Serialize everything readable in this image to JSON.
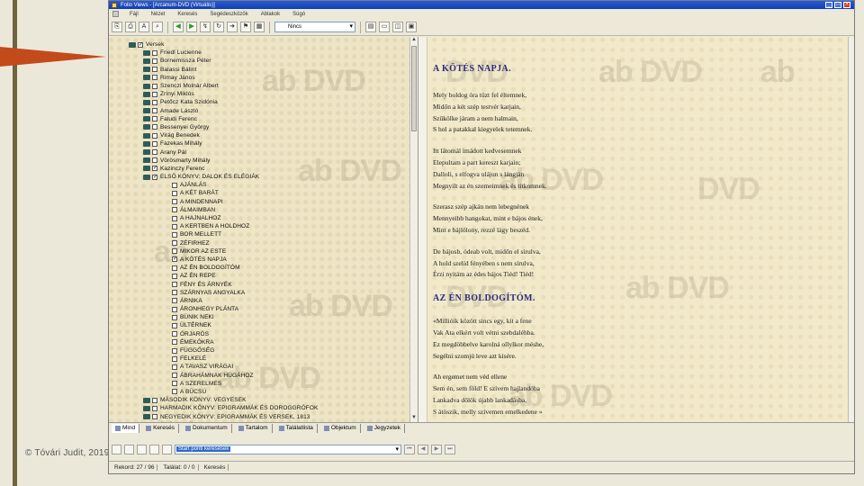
{
  "slide": {
    "copyright": "© Tóvári Judit, 2019"
  },
  "window": {
    "title": "Folio Views - [Arcanum-DVD (Virtuális)]"
  },
  "menu": [
    "Fájl",
    "Nézet",
    "Keresés",
    "Segédeszközök",
    "Ablakok",
    "Súgó"
  ],
  "toolbar": {
    "style_select_value": "Nincs"
  },
  "tree": {
    "root": "Versek",
    "poets": [
      "Friedl Lucienne",
      "Bornemissza Péter",
      "Balassi Bálint",
      "Rimay János",
      "Szenczi Molnár Albert",
      "Zrínyi Miklós",
      "Petőcz Kata Szidónia",
      "Amade László",
      "Faludi Ferenc",
      "Bessenyei György",
      "Virág Benedek",
      "Fazekas Mihály",
      "Arany Pál",
      "Vörösmarty Mihály"
    ],
    "poet_open": "Kazinczy Ferenc",
    "book_open": "ELSŐ KÖNYV: DALOK ÉS ELÉGIÁK",
    "poems": [
      "AJÁNLÁS",
      "A KÉT BARÁT",
      "A MINDENNAPI",
      "ÁLMAIMBAN",
      "A HAJNALHOZ",
      "A KERTBEN A HOLDHOZ",
      "BOR MELLETT",
      "ZÉFIRHEZ",
      "MIKOR AZ ESTE",
      "A KÖTÉS NAPJA",
      "AZ ÉN BOLDOGÍTÓM",
      "AZ ÉN REPE",
      "FÉNY ÉS ÁRNYÉK",
      "SZÁRNYAS ANGYALKA",
      "ÁRNIKA",
      "ÁRONHEGY PLÁNTA",
      "BÚNIK NEKI",
      "ÜLTÉRNEK",
      "ÓRJARÓS",
      "ÉMEKÓKRA",
      "FÜGGÖSÉG",
      "FELKELÉ",
      "A TAVASZ VIRÁGAI",
      "ÁBRAHÁMNAK HÚGÁHOZ",
      "A SZERELMES",
      "A BÚCSÚ"
    ],
    "checked_poem_index": 9,
    "books_after": [
      "MÁSODIK KÖNYV: VEGYESEK",
      "HARMADIK KÖNYV: EPIGRAMMÁK ÉS DOROGGRÓFOK",
      "NEGYEDIK KÖNYV: EPIGRAMMÁK ÉS VERSEK, 1813",
      "ÖTÖDIK KÖNYV: ALKALMI VERSEK"
    ]
  },
  "document": {
    "poem1_title": "A KÖTÉS NAPJA.",
    "poem1_stanzas": [
      [
        "Mely boldog óra tüzt fel éltemnek,",
        "Midőn a két szép testvér karjain,",
        "Szűkölke járam a nem halmain,",
        "S hol a patakkal kiegyelek tetemnek."
      ],
      [
        "Itt látomál imádott kedvesemnek",
        "Elepultam a part kereszt karjain;",
        "Dalloli, s elfogva ulájun s lángján",
        "Megnyílt az én szemeimnek és titkomnek."
      ],
      [
        "Szerasz szép ajkán nem lebegnének",
        "Mennyeibb hangokat, mint e bájos ének,",
        "Mint e bájlólony, rezzé lágy beszéd."
      ],
      [
        "De bájosb, ódeab volt, midőn el sírulva,",
        "A hold szelíd fényében s nem sírulva,",
        "Érzi nyitám az édes bájos Tiéd! Tiéd!"
      ]
    ],
    "poem2_title": "AZ ÉN BOLDOGÍTÓM.",
    "poem2_stanzas": [
      [
        "«Millióik között sincs egy, kit a fene",
        "Vak Ata elkért volt vétni szebdaléhba.",
        "Ez megdöbbelve karolná ollylkor méshe,",
        "Segélni szomjú leve azt kisére."
      ],
      [
        "Ah ergemet nem véd ellene",
        "Sem én, sem föld! E szívem hajlandóba",
        "Lankadva dőlök újabb lankadásba,",
        "S átöszik, melly szívemen emelkedene »"
      ]
    ]
  },
  "tabs": [
    "Mind",
    "Keresés",
    "Dokumentum",
    "Tartalom",
    "Találatlista",
    "Objektum",
    "Jegyzetek"
  ],
  "query": {
    "value": "Start ponti keresések"
  },
  "status": {
    "record": "Rekord: 27 / 96",
    "hits": "Találat: 0 / 0",
    "mode": "Keresés"
  }
}
